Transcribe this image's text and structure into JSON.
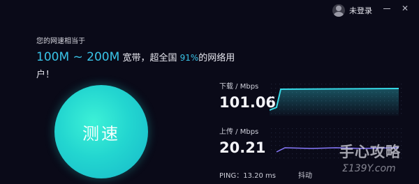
{
  "header": {
    "user_label": "未登录",
    "close_glyph": "✕"
  },
  "result": {
    "intro": "您的网速相当于",
    "range": "100M ~ 200M",
    "desc_part1": "宽带，超全国",
    "percent": "91%",
    "desc_part2": "的网络用户！"
  },
  "test_button": {
    "label": "测速"
  },
  "download": {
    "label": "下载 / Mbps",
    "value": "101.06"
  },
  "upload": {
    "label": "上传 / Mbps",
    "value": "20.21"
  },
  "ping": {
    "text": "PING：13.20 ms"
  },
  "jitter": {
    "label": "抖动"
  },
  "watermark": {
    "text": "手心攻略",
    "sub": "Σ139Y.com"
  },
  "colors": {
    "accent": "#39c4e8",
    "button": "#23d6d0",
    "download_line": "#36d9e6",
    "upload_line": "#8a7bff",
    "background": "#0a0a18"
  },
  "icons": [
    "user-avatar-icon",
    "minimize-icon",
    "close-icon"
  ]
}
